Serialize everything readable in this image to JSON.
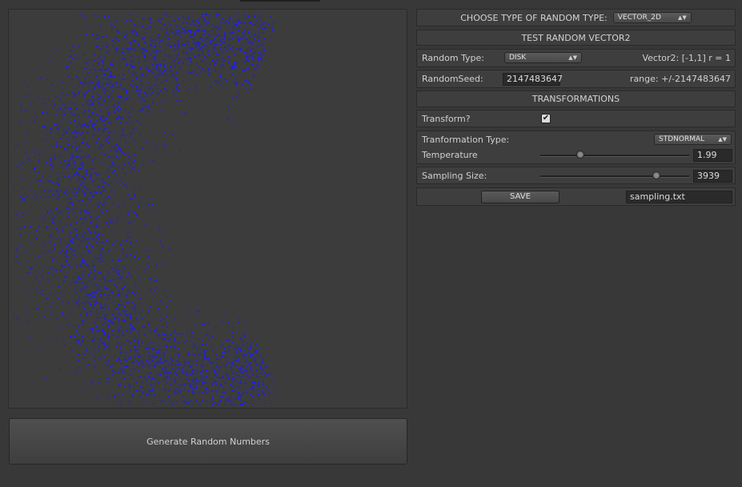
{
  "header": {
    "choose_label": "CHOOSE TYPE OF RANDOM TYPE:",
    "type_value": "VECTOR_2D"
  },
  "test_title": "TEST RANDOM VECTOR2",
  "random_type": {
    "label": "Random Type:",
    "value": "DISK",
    "info": "Vector2: [-1,1] r = 1"
  },
  "seed": {
    "label": "RandomSeed:",
    "value": "2147483647",
    "range": "range: +/-2147483647"
  },
  "transformations_title": "TRANSFORMATIONS",
  "transform": {
    "label": "Transform?",
    "checked": true,
    "check_glyph": "✔"
  },
  "transformation_type": {
    "label": "Tranformation Type:",
    "value": "STDNORMAL"
  },
  "temperature": {
    "label": "Temperature",
    "value": "1.99",
    "level": 0.27
  },
  "sampling": {
    "label": "Sampling Size:",
    "value": "3939",
    "level": 0.78
  },
  "save": {
    "button_label": "SAVE",
    "filename": "sampling.txt"
  },
  "generate_label": "Generate Random Numbers",
  "colors": {
    "point": "#1a1aff",
    "panel_bg": "#3c3c3c",
    "window_bg": "#383838"
  },
  "icons": {
    "popup_arrows": "up-down-arrows-icon",
    "checkbox": "checkmark-icon"
  }
}
